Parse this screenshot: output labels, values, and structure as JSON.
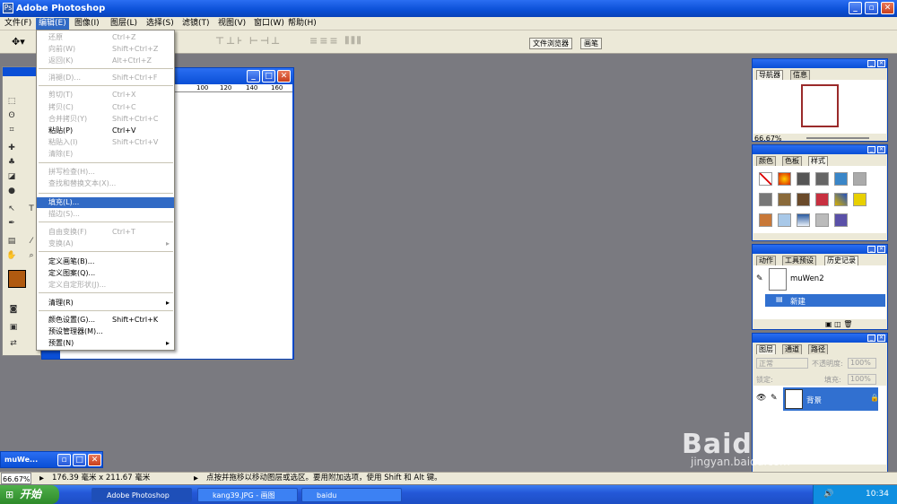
{
  "app": {
    "title": "Adobe Photoshop"
  },
  "menubar": [
    "文件(F)",
    "编辑(E)",
    "图像(I)",
    "图层(L)",
    "选择(S)",
    "滤镜(T)",
    "视图(V)",
    "窗口(W)",
    "帮助(H)"
  ],
  "well_tabs": [
    "文件浏览器",
    "画笔"
  ],
  "edit_menu": [
    {
      "label": "还原",
      "shortcut": "Ctrl+Z",
      "disabled": true
    },
    {
      "label": "向前(W)",
      "shortcut": "Shift+Ctrl+Z",
      "disabled": true
    },
    {
      "label": "返回(K)",
      "shortcut": "Alt+Ctrl+Z",
      "disabled": true
    },
    {
      "label": "消褪(D)...",
      "shortcut": "Shift+Ctrl+F",
      "disabled": true
    },
    {
      "label": "剪切(T)",
      "shortcut": "Ctrl+X",
      "disabled": true
    },
    {
      "label": "拷贝(C)",
      "shortcut": "Ctrl+C",
      "disabled": true
    },
    {
      "label": "合并拷贝(Y)",
      "shortcut": "Shift+Ctrl+C",
      "disabled": true
    },
    {
      "label": "粘贴(P)",
      "shortcut": "Ctrl+V",
      "disabled": false
    },
    {
      "label": "粘贴入(I)",
      "shortcut": "Shift+Ctrl+V",
      "disabled": true
    },
    {
      "label": "清除(E)",
      "shortcut": "",
      "disabled": true
    },
    {
      "label": "拼写检查(H)...",
      "shortcut": "",
      "disabled": true
    },
    {
      "label": "查找和替换文本(X)...",
      "shortcut": "",
      "disabled": true
    },
    {
      "label": "填充(L)...",
      "shortcut": "",
      "highlighted": true
    },
    {
      "label": "描边(S)...",
      "shortcut": "",
      "disabled": true
    },
    {
      "label": "自由变换(F)",
      "shortcut": "Ctrl+T",
      "disabled": true
    },
    {
      "label": "变换(A)",
      "shortcut": "",
      "disabled": true,
      "submenu": true
    },
    {
      "label": "定义画笔(B)...",
      "shortcut": ""
    },
    {
      "label": "定义图案(Q)...",
      "shortcut": ""
    },
    {
      "label": "定义自定形状(J)...",
      "shortcut": "",
      "disabled": true
    },
    {
      "label": "清理(R)",
      "shortcut": "",
      "submenu": true
    },
    {
      "label": "颜色设置(G)...",
      "shortcut": "Shift+Ctrl+K"
    },
    {
      "label": "预设管理器(M)...",
      "shortcut": ""
    },
    {
      "label": "预置(N)",
      "shortcut": "",
      "submenu": true
    }
  ],
  "navigator": {
    "tabs": [
      "导航器",
      "信息"
    ],
    "zoom": "66.67%"
  },
  "color_panel": {
    "tabs": [
      "颜色",
      "色板",
      "样式"
    ]
  },
  "history_panel": {
    "tabs": [
      "动作",
      "工具预设",
      "历史记录"
    ],
    "snapshot": "muWen2",
    "state": "新建"
  },
  "layers_panel": {
    "tabs": [
      "图层",
      "通道",
      "路径"
    ],
    "blend": "正常",
    "opacity_label": "不透明度:",
    "opacity": "100%",
    "lock_label": "锁定:",
    "fill_label": "填充:",
    "fill": "100%",
    "layer_name": "背景"
  },
  "minimized_doc": {
    "title": "muWe..."
  },
  "status": {
    "zoom": "66.67%",
    "size": "176.39 毫米 x 211.67 毫米",
    "hint": "点按并拖移以移动图层或选区。要用附加选项，使用 Shift 和 Alt 键。"
  },
  "ruler_ticks": [
    "100",
    "120",
    "140",
    "160"
  ],
  "taskbar": {
    "start": "开始",
    "tasks": [
      "Adobe Photoshop",
      "kang39.JPG - 画图",
      "baidu"
    ],
    "time": "10:34"
  },
  "watermark": {
    "brand": "Baidu经验",
    "url": "jingyan.baidu.com"
  },
  "colors": {
    "foreground": "#b05a10",
    "titlebar": "#0a4fd6",
    "menu_highlight": "#316ac5",
    "history_selected": "#3170d0"
  }
}
